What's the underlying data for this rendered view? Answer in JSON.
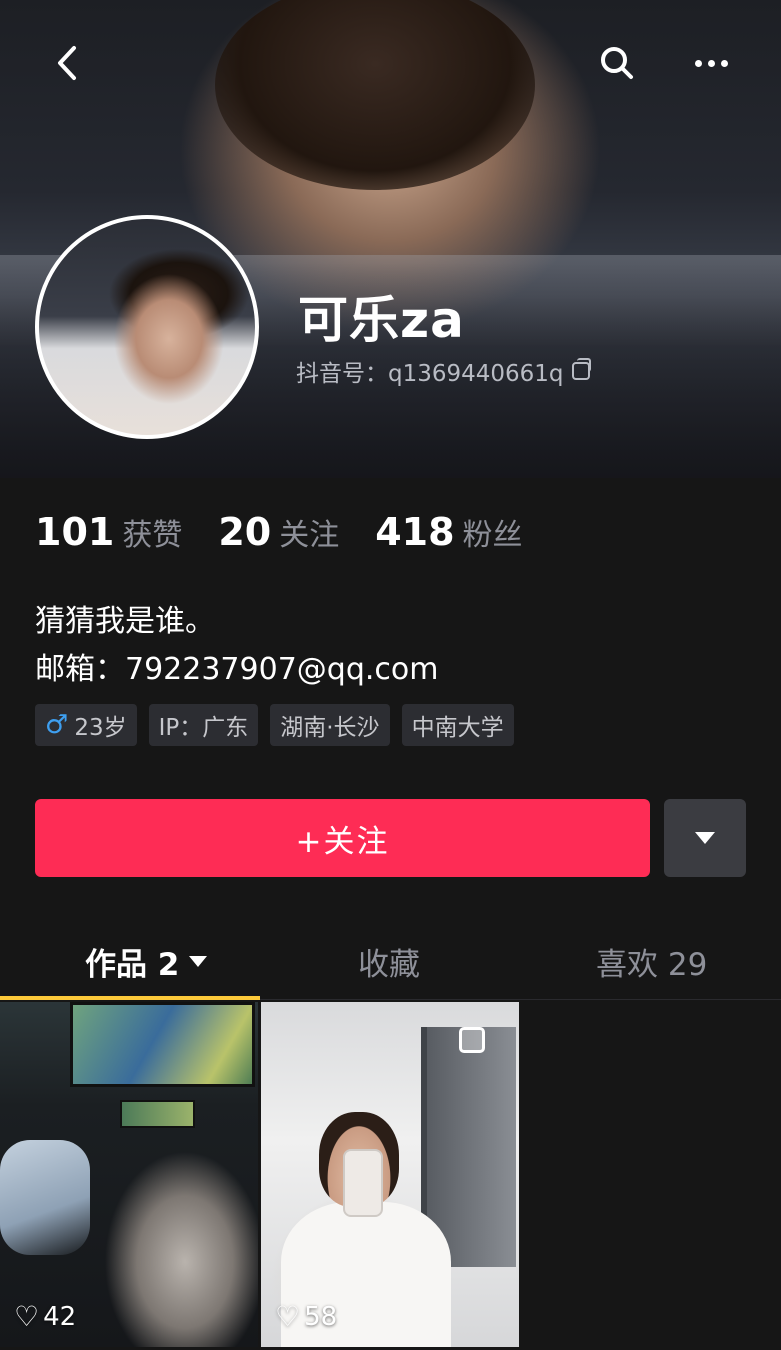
{
  "profile": {
    "name": "可乐za",
    "douyin_id": "抖音号：q1369440661q"
  },
  "stats": [
    {
      "num": "101",
      "label": "获赞"
    },
    {
      "num": "20",
      "label": "关注"
    },
    {
      "num": "418",
      "label": "粉丝"
    }
  ],
  "bio": {
    "line1": "猜猜我是谁。",
    "line2": "邮箱：792237907@qq.com"
  },
  "tags": {
    "gender_symbol": "♂",
    "age": "23岁",
    "ip": "IP：广东",
    "location": "湖南·长沙",
    "school": "中南大学"
  },
  "actions": {
    "follow_label": "+关注"
  },
  "tabs": {
    "works": "作品 2",
    "favorites": "收藏",
    "likes": "喜欢 29"
  },
  "posts": [
    {
      "likes": "42"
    },
    {
      "likes": "58"
    }
  ],
  "colors": {
    "accent": "#fe2c55",
    "tab_indicator": "#fdc93a",
    "male": "#3e9ff0",
    "background": "#161616"
  },
  "icons": {
    "back": "chevron-left-icon",
    "search": "search-icon",
    "more": "more-icon",
    "copy": "copy-icon",
    "heart": "heart-icon",
    "dropdown": "caret-down-icon"
  }
}
